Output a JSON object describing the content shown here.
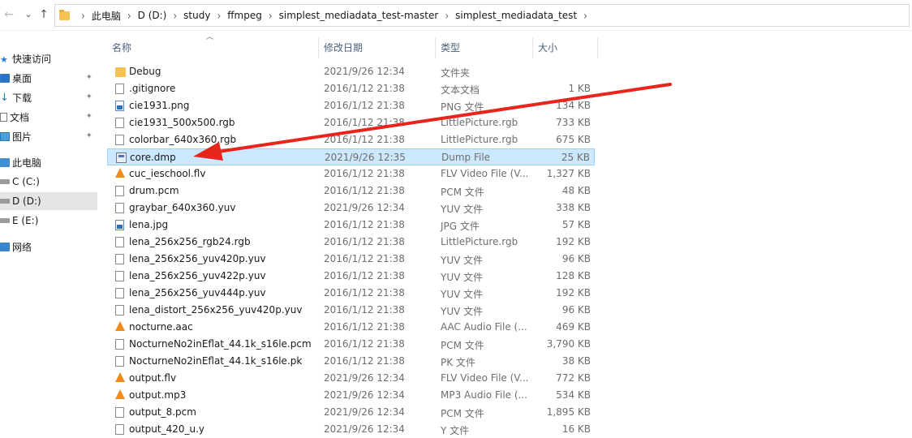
{
  "nav": {
    "back": "←",
    "forward": "→",
    "up": "↑",
    "recent": "⌄"
  },
  "breadcrumb": [
    "此电脑",
    "D (D:)",
    "study",
    "ffmpeg",
    "simplest_mediadata_test-master",
    "simplest_mediadata_test"
  ],
  "sidebar": {
    "items": [
      {
        "label": "快速访问",
        "icon": "star-icon",
        "pinned": false
      },
      {
        "label": "桌面",
        "icon": "desktop-icon",
        "pinned": true
      },
      {
        "label": "下载",
        "icon": "download-icon",
        "pinned": true
      },
      {
        "label": "文档",
        "icon": "document-icon",
        "pinned": true
      },
      {
        "label": "图片",
        "icon": "pictures-icon",
        "pinned": true
      },
      {
        "label": "此电脑",
        "icon": "computer-icon",
        "pinned": false
      },
      {
        "label": "C (C:)",
        "icon": "drive-icon",
        "pinned": false
      },
      {
        "label": "D (D:)",
        "icon": "drive-icon",
        "pinned": false,
        "selected": true
      },
      {
        "label": "E (E:)",
        "icon": "drive-icon",
        "pinned": false
      },
      {
        "label": "网络",
        "icon": "network-icon",
        "pinned": false
      }
    ],
    "pin_glyph": "📌"
  },
  "columns": {
    "name": "名称",
    "date": "修改日期",
    "type": "类型",
    "size": "大小"
  },
  "files": [
    {
      "name": "Debug",
      "date": "2021/9/26 12:34",
      "type": "文件夹",
      "size": "",
      "icon": "folder"
    },
    {
      "name": ".gitignore",
      "date": "2016/1/12 21:38",
      "type": "文本文档",
      "size": "1 KB",
      "icon": "doc"
    },
    {
      "name": "cie1931.png",
      "date": "2016/1/12 21:38",
      "type": "PNG 文件",
      "size": "134 KB",
      "icon": "img"
    },
    {
      "name": "cie1931_500x500.rgb",
      "date": "2016/1/12 21:38",
      "type": "LittlePicture.rgb",
      "size": "733 KB",
      "icon": "doc"
    },
    {
      "name": "colorbar_640x360.rgb",
      "date": "2016/1/12 21:38",
      "type": "LittlePicture.rgb",
      "size": "675 KB",
      "icon": "doc"
    },
    {
      "name": "core.dmp",
      "date": "2021/9/26 12:35",
      "type": "Dump File",
      "size": "25 KB",
      "icon": "dmp",
      "selected": true
    },
    {
      "name": "cuc_ieschool.flv",
      "date": "2016/1/12 21:38",
      "type": "FLV Video File (V...",
      "size": "1,327 KB",
      "icon": "vlc"
    },
    {
      "name": "drum.pcm",
      "date": "2016/1/12 21:38",
      "type": "PCM 文件",
      "size": "48 KB",
      "icon": "doc"
    },
    {
      "name": "graybar_640x360.yuv",
      "date": "2021/9/26 12:34",
      "type": "YUV 文件",
      "size": "338 KB",
      "icon": "doc"
    },
    {
      "name": "lena.jpg",
      "date": "2016/1/12 21:38",
      "type": "JPG 文件",
      "size": "57 KB",
      "icon": "img"
    },
    {
      "name": "lena_256x256_rgb24.rgb",
      "date": "2016/1/12 21:38",
      "type": "LittlePicture.rgb",
      "size": "192 KB",
      "icon": "doc"
    },
    {
      "name": "lena_256x256_yuv420p.yuv",
      "date": "2016/1/12 21:38",
      "type": "YUV 文件",
      "size": "96 KB",
      "icon": "doc"
    },
    {
      "name": "lena_256x256_yuv422p.yuv",
      "date": "2016/1/12 21:38",
      "type": "YUV 文件",
      "size": "128 KB",
      "icon": "doc"
    },
    {
      "name": "lena_256x256_yuv444p.yuv",
      "date": "2016/1/12 21:38",
      "type": "YUV 文件",
      "size": "192 KB",
      "icon": "doc"
    },
    {
      "name": "lena_distort_256x256_yuv420p.yuv",
      "date": "2016/1/12 21:38",
      "type": "YUV 文件",
      "size": "96 KB",
      "icon": "doc"
    },
    {
      "name": "nocturne.aac",
      "date": "2016/1/12 21:38",
      "type": "AAC Audio File (...",
      "size": "469 KB",
      "icon": "vlc"
    },
    {
      "name": "NocturneNo2inEflat_44.1k_s16le.pcm",
      "date": "2016/1/12 21:38",
      "type": "PCM 文件",
      "size": "3,790 KB",
      "icon": "doc"
    },
    {
      "name": "NocturneNo2inEflat_44.1k_s16le.pk",
      "date": "2016/1/12 21:38",
      "type": "PK 文件",
      "size": "38 KB",
      "icon": "doc"
    },
    {
      "name": "output.flv",
      "date": "2021/9/26 12:34",
      "type": "FLV Video File (V...",
      "size": "772 KB",
      "icon": "vlc"
    },
    {
      "name": "output.mp3",
      "date": "2021/9/26 12:34",
      "type": "MP3 Audio File (...",
      "size": "534 KB",
      "icon": "vlc"
    },
    {
      "name": "output_8.pcm",
      "date": "2021/9/26 12:34",
      "type": "PCM 文件",
      "size": "1,895 KB",
      "icon": "doc"
    },
    {
      "name": "output_420_u.y",
      "date": "2021/9/26 12:34",
      "type": "Y 文件",
      "size": "16 KB",
      "icon": "doc"
    }
  ],
  "colors": {
    "selected_bg": "#cce8ff",
    "selected_border": "#99d1ff",
    "annotation": "#e8251c"
  }
}
